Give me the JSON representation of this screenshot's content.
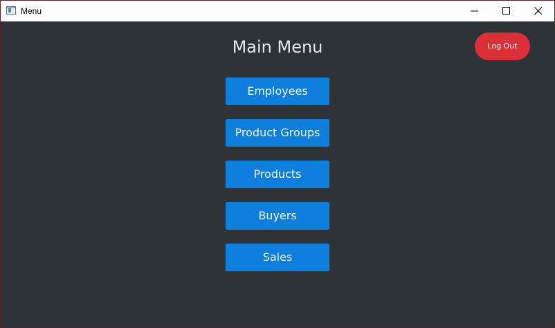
{
  "window": {
    "title": "Menu"
  },
  "icons": {
    "app": "app-window-icon",
    "minimize": "minimize-icon",
    "maximize": "maximize-icon",
    "close": "close-icon"
  },
  "colors": {
    "background": "#2d3337",
    "primary_button": "#0f7fde",
    "danger_button": "#dc3038",
    "heading_text": "#e8e8e8"
  },
  "main": {
    "heading": "Main Menu",
    "logout_label": "Log Out",
    "menu_items": [
      {
        "label": "Employees"
      },
      {
        "label": "Product Groups"
      },
      {
        "label": "Products"
      },
      {
        "label": "Buyers"
      },
      {
        "label": "Sales"
      }
    ]
  }
}
